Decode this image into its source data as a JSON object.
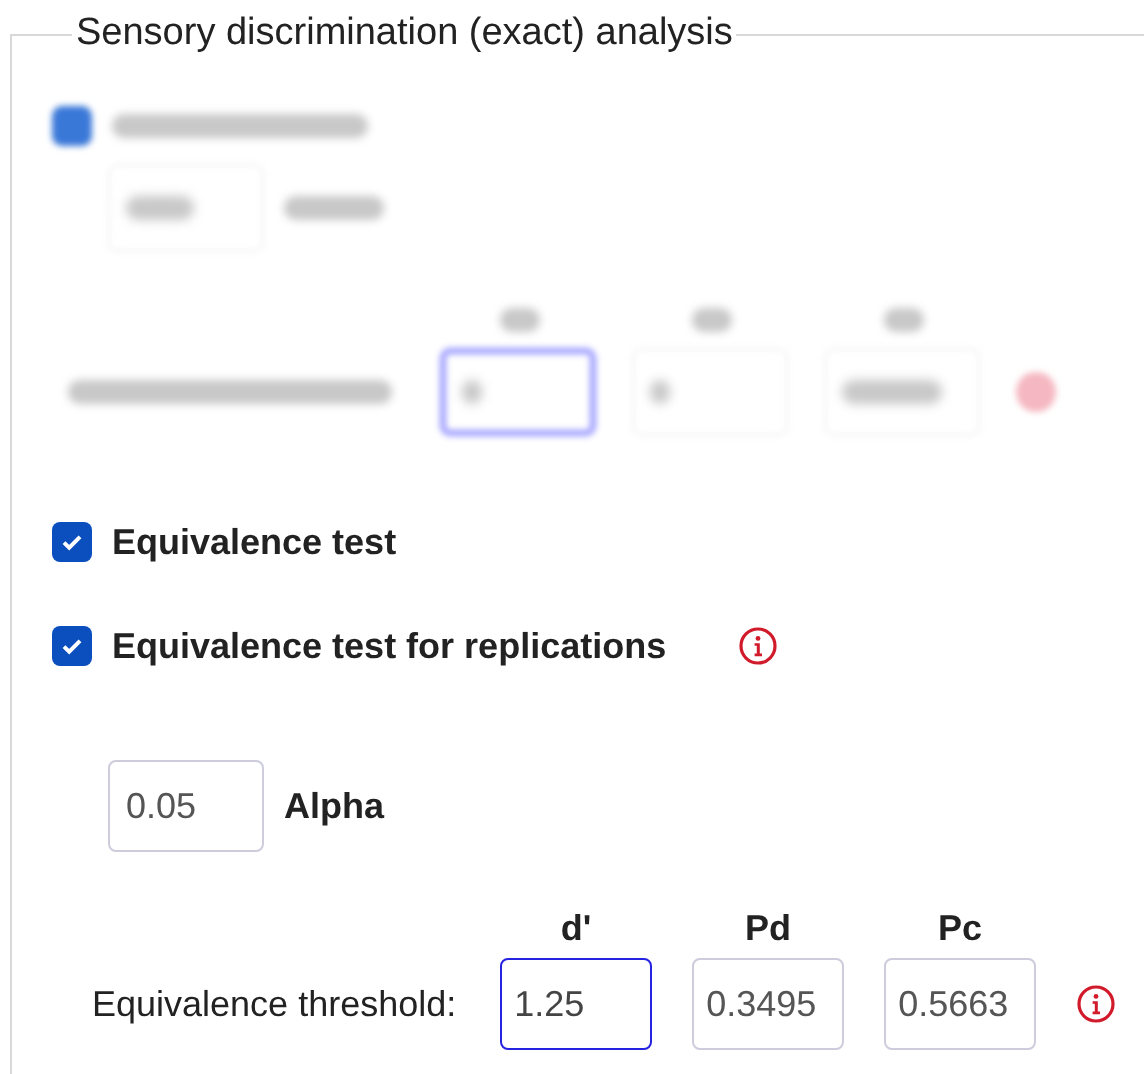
{
  "panel": {
    "title": "Sensory discrimination (exact) analysis"
  },
  "items": [
    {
      "kind": "blurred-checkbox",
      "checked": true
    },
    {
      "kind": "blurred-alpha"
    },
    {
      "kind": "blurred-threshold",
      "info": true,
      "fields": [
        {
          "focused": true
        },
        {
          "focused": false
        },
        {
          "focused": false
        }
      ]
    },
    {
      "kind": "checkbox",
      "label": "Equivalence test",
      "checked": true,
      "info": false
    },
    {
      "kind": "checkbox",
      "label": "Equivalence test for replications",
      "checked": true,
      "info": true
    },
    {
      "kind": "alpha",
      "value": "0.05",
      "label": "Alpha"
    },
    {
      "kind": "threshold",
      "label": "Equivalence threshold:",
      "info": true,
      "fields": [
        {
          "header": "d'",
          "value": "1.25",
          "focused": true
        },
        {
          "header": "Pd",
          "value": "0.3495",
          "focused": false
        },
        {
          "header": "Pc",
          "value": "0.5663",
          "focused": false
        }
      ]
    }
  ]
}
